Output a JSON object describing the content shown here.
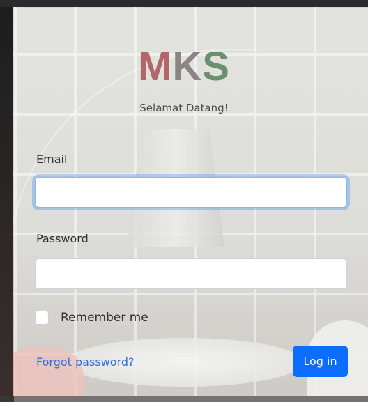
{
  "brand": {
    "letters": [
      "M",
      "K",
      "S"
    ]
  },
  "header": {
    "welcome": "Selamat Datang!"
  },
  "form": {
    "email_label": "Email",
    "email_value": "",
    "password_label": "Password",
    "password_value": "",
    "remember_label": "Remember me",
    "remember_checked": false,
    "forgot_link": "Forgot password?",
    "login_button": "Log in"
  },
  "colors": {
    "primary": "#0d6efd",
    "link": "#2f6fd6",
    "logo_m": "#b2686a",
    "logo_k": "#8c8385",
    "logo_s": "#6b9070"
  }
}
